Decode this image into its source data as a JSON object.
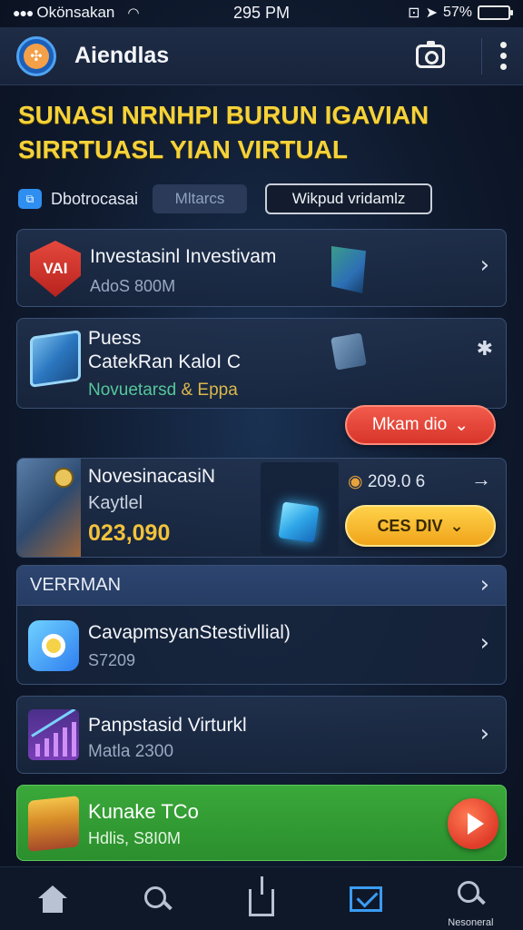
{
  "status": {
    "carrier": "Okönsakan",
    "time": "295 PM",
    "battery": "57%"
  },
  "appbar": {
    "title": "Aiendlas",
    "logo_glyph": "✣",
    "icons": [
      "camera-icon",
      "more-vert-icon"
    ]
  },
  "headline": {
    "line1": "SUNASI NRNHPI BURUN IGAVIAN",
    "line2": "SIRRTUASL YIAN VIRTUAL"
  },
  "filters": {
    "label": "Dbotrocasai",
    "chip_a": "Mltarcs",
    "chip_b": "Wikpud vridamlz"
  },
  "cards": {
    "c1": {
      "title": "Investasinl Investivam",
      "sub": "AdoS 800M",
      "badge": "VAI"
    },
    "c2": {
      "line1": "Puess",
      "line2": "CatekRan KaloI C",
      "line3a": "Novuetarsd",
      "line3b": " & Eppa",
      "close": "✱"
    },
    "c2_button": "Mkam dio",
    "c3": {
      "title": "NovesinacasiN",
      "sub": "Kaytlel",
      "value": "023,090",
      "amount": "209.0 6",
      "coin": "ᵒ"
    },
    "c3_button": "CES DIV",
    "section": {
      "header": "VERRMAN",
      "row_title": "CavapmsyanStestivllial)",
      "row_sub": "S7209"
    },
    "c5": {
      "title": "Panpstasid Virturkl",
      "sub": "Matla 2300"
    },
    "c6": {
      "title": "Kunake TCo",
      "sub": "Hdlis, S8I0M"
    }
  },
  "tabbar": {
    "last_label": "Nesoneral"
  },
  "colors": {
    "accent": "#f5d23a",
    "primary_blue": "#3b9cf2",
    "cta_red": "#e03c2a",
    "cta_yellow": "#f0a41a",
    "promo_green": "#2b8f2d"
  }
}
